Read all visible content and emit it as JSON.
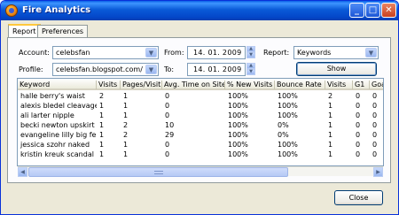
{
  "window": {
    "title": "Fire Analytics"
  },
  "tabs": [
    {
      "label": "Report"
    },
    {
      "label": "Preferences"
    }
  ],
  "form": {
    "account_label": "Account:",
    "account_value": "celebsfan",
    "profile_label": "Profile:",
    "profile_value": "celebsfan.blogspot.com/",
    "from_label": "From:",
    "from_value": "14. 01. 2009",
    "to_label": "To:",
    "to_value": "14. 01. 2009",
    "report_label": "Report:",
    "report_value": "Keywords",
    "show_button": "Show"
  },
  "table": {
    "columns": [
      "Keyword",
      "Visits",
      "Pages/Visit",
      "Avg. Time on Site",
      "% New Visits",
      "Bounce Rate",
      "Visits",
      "G1",
      "Goal"
    ],
    "rows": [
      [
        "halle berry's waist",
        "2",
        "1",
        "0",
        "100%",
        "100%",
        "2",
        "0",
        "0"
      ],
      [
        "alexis bledel cleavage",
        "1",
        "1",
        "0",
        "100%",
        "100%",
        "1",
        "0",
        "0"
      ],
      [
        "ali larter nipple",
        "1",
        "1",
        "0",
        "100%",
        "100%",
        "1",
        "0",
        "0"
      ],
      [
        "becki newton upskirt",
        "1",
        "2",
        "10",
        "100%",
        "0%",
        "1",
        "0",
        "0"
      ],
      [
        "evangeline lilly big feet",
        "1",
        "2",
        "29",
        "100%",
        "0%",
        "1",
        "0",
        "0"
      ],
      [
        "jessica szohr naked",
        "1",
        "1",
        "0",
        "100%",
        "100%",
        "1",
        "0",
        "0"
      ],
      [
        "kristin kreuk scandal",
        "1",
        "1",
        "0",
        "100%",
        "100%",
        "1",
        "0",
        "0"
      ]
    ]
  },
  "footer": {
    "close_button": "Close"
  },
  "icons": {
    "app": "fire-analytics-icon",
    "minimize": "minimize-icon",
    "maximize": "maximize-icon",
    "close": "close-icon",
    "dropdown": "chevron-down-icon",
    "spinner": "spinner-icon"
  },
  "colors": {
    "titlebar": "#0a5ad8",
    "window_bg": "#ece9d8",
    "active_tab_accent": "#ffc83c"
  }
}
